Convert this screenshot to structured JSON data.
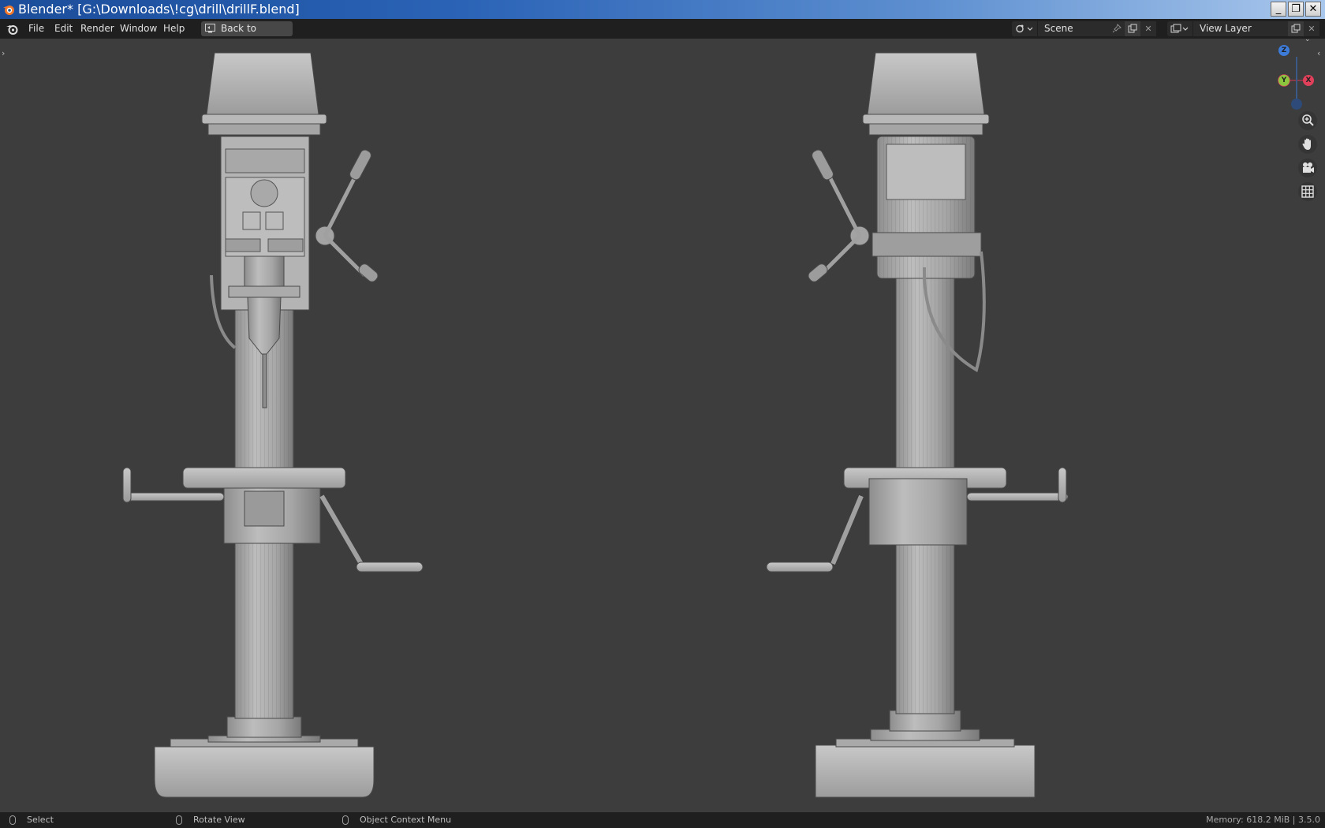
{
  "window": {
    "title": "Blender* [G:\\Downloads\\!cg\\drill\\drillF.blend]",
    "buttons": {
      "minimize": "_",
      "restore": "❐",
      "close": "✕"
    }
  },
  "menubar": {
    "items": [
      "File",
      "Edit",
      "Render",
      "Window",
      "Help"
    ],
    "back_button": "Back to Previous",
    "scene": {
      "label": "Scene"
    },
    "view_layer": {
      "label": "View Layer"
    }
  },
  "gizmo": {
    "z": "Z",
    "y": "Y",
    "x": "X"
  },
  "statusbar": {
    "select": "Select",
    "rotate": "Rotate View",
    "context": "Object Context Menu",
    "memory": "Memory: 618.2 MiB | 3.5.0"
  },
  "colors": {
    "accent_x": "#e0405a",
    "accent_y": "#8cc63f",
    "accent_z": "#3d7bd9",
    "viewport_bg": "#3d3d3d",
    "header_bg": "#1f1f1f"
  }
}
